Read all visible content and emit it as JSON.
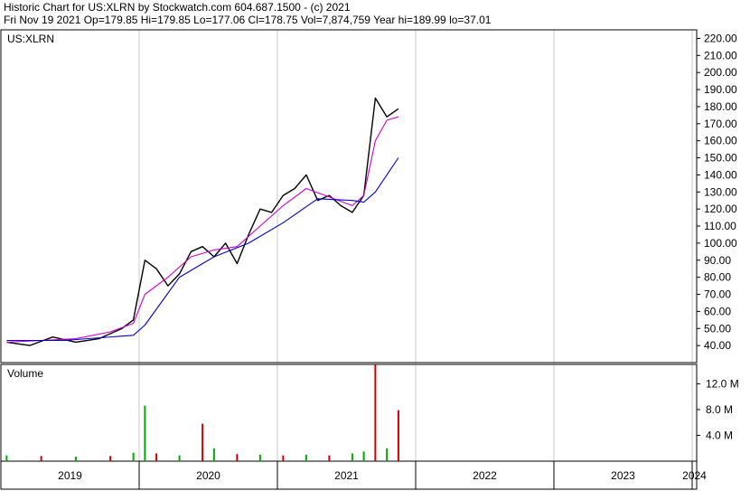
{
  "header": {
    "title": "Historic Chart for US:XLRN by Stockwatch.com 604.687.1500 - (c) 2021",
    "quote": "Fri Nov 19 2021  Op=179.85  Hi=179.85  Lo=177.06  Cl=178.75  Vol=7,874,759  Year hi=189.99  lo=37.01"
  },
  "colors": {
    "price": "#000000",
    "ma_short": "#cc00cc",
    "ma_long": "#0000cc",
    "volume_up": "#00aa00",
    "volume_down": "#cc0000",
    "grid": "#c8c8c8"
  },
  "chart_data": [
    {
      "type": "line",
      "title": "US:XLRN",
      "ylim": [
        30,
        225
      ],
      "y_ticks": [
        "220.00",
        "210.00",
        "200.00",
        "190.00",
        "180.00",
        "170.00",
        "160.00",
        "150.00",
        "140.00",
        "130.00",
        "120.00",
        "110.00",
        "100.00",
        "90.00",
        "80.00",
        "70.00",
        "60.00",
        "50.00",
        "40.00"
      ],
      "x_ticks": [
        "2019",
        "2020",
        "2021",
        "2022",
        "2023",
        "2024"
      ],
      "series": [
        {
          "style": "price",
          "x": [
            "2019-01",
            "2019-03",
            "2019-05",
            "2019-07",
            "2019-09",
            "2019-11",
            "2019-12",
            "2020-01",
            "2020-02",
            "2020-03",
            "2020-04",
            "2020-05",
            "2020-06",
            "2020-07",
            "2020-08",
            "2020-09",
            "2020-10",
            "2020-11",
            "2020-12",
            "2021-01",
            "2021-02",
            "2021-03",
            "2021-04",
            "2021-05",
            "2021-06",
            "2021-07",
            "2021-08",
            "2021-09",
            "2021-10",
            "2021-11"
          ],
          "y": [
            42,
            40,
            45,
            42,
            44,
            50,
            55,
            90,
            85,
            75,
            82,
            95,
            98,
            92,
            100,
            88,
            105,
            120,
            118,
            128,
            132,
            140,
            125,
            128,
            122,
            118,
            128,
            185,
            174,
            178.75
          ]
        },
        {
          "style": "ma_short",
          "x": [
            "2019-01",
            "2019-04",
            "2019-07",
            "2019-10",
            "2019-12",
            "2020-01",
            "2020-03",
            "2020-05",
            "2020-07",
            "2020-09",
            "2020-11",
            "2021-01",
            "2021-03",
            "2021-05",
            "2021-07",
            "2021-08",
            "2021-09",
            "2021-10",
            "2021-11"
          ],
          "y": [
            42,
            43,
            44,
            48,
            53,
            70,
            80,
            92,
            96,
            98,
            110,
            122,
            132,
            127,
            122,
            128,
            160,
            172,
            174
          ]
        },
        {
          "style": "ma_long",
          "x": [
            "2019-01",
            "2019-06",
            "2019-12",
            "2020-01",
            "2020-04",
            "2020-07",
            "2020-10",
            "2021-01",
            "2021-04",
            "2021-07",
            "2021-08",
            "2021-09",
            "2021-10",
            "2021-11"
          ],
          "y": [
            43,
            43,
            46,
            52,
            80,
            92,
            100,
            112,
            126,
            125,
            124,
            130,
            140,
            150
          ]
        }
      ]
    },
    {
      "type": "bar",
      "title": "Volume",
      "ylim": [
        0,
        15
      ],
      "y_ticks": [
        "12.0 M",
        "8.0 M",
        "4.0 M"
      ],
      "x": [
        "2019-01",
        "2019-04",
        "2019-07",
        "2019-10",
        "2019-12",
        "2020-01",
        "2020-02",
        "2020-04",
        "2020-06",
        "2020-07",
        "2020-09",
        "2020-11",
        "2021-01",
        "2021-03",
        "2021-05",
        "2021-07",
        "2021-08",
        "2021-09",
        "2021-10",
        "2021-11"
      ],
      "values": [
        0.9,
        0.8,
        0.7,
        0.8,
        1.3,
        8.6,
        1.2,
        0.9,
        5.8,
        2.0,
        1.1,
        1.0,
        0.9,
        1.0,
        0.9,
        1.2,
        1.5,
        15.0,
        2.0,
        7.9
      ],
      "direction": [
        "up",
        "down",
        "up",
        "down",
        "up",
        "up",
        "down",
        "up",
        "down",
        "up",
        "down",
        "up",
        "down",
        "up",
        "down",
        "up",
        "up",
        "down",
        "up",
        "down"
      ]
    }
  ]
}
